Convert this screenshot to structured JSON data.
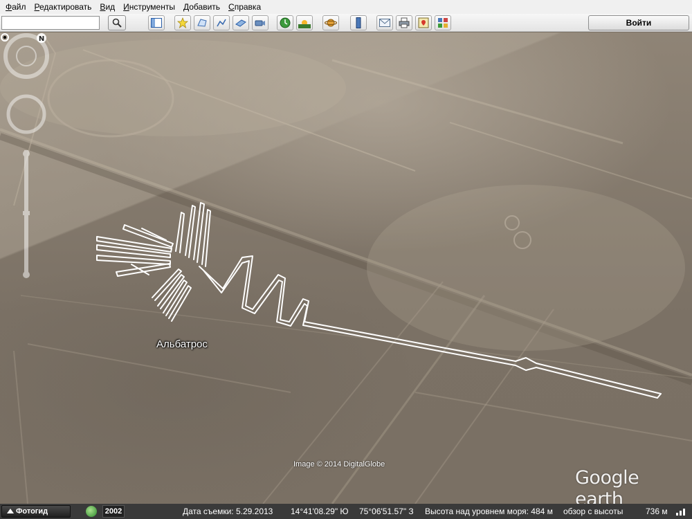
{
  "menu": [
    {
      "label": "Файл",
      "key": "Ф",
      "rest": "айл"
    },
    {
      "label": "Редактировать",
      "key": "Р",
      "rest": "едактировать"
    },
    {
      "label": "Вид",
      "key": "В",
      "rest": "ид"
    },
    {
      "label": "Инструменты",
      "key": "И",
      "rest": "нструменты"
    },
    {
      "label": "Добавить",
      "key": "Д",
      "rest": "обавить"
    },
    {
      "label": "Справка",
      "key": "С",
      "rest": "правка"
    }
  ],
  "search": {
    "value": "",
    "placeholder": ""
  },
  "toolbar": {
    "login_label": "Войти",
    "buttons": [
      "sidebar-icon",
      "placemark-icon",
      "polygon-icon",
      "path-icon",
      "image-overlay-icon",
      "record-tour-icon",
      "historical-imagery-icon",
      "sunlight-icon",
      "planets-icon",
      "ruler-icon",
      "email-icon",
      "print-icon",
      "view-in-maps-icon"
    ]
  },
  "map": {
    "placemark_label": "Альбатрос",
    "image_credit": "Image © 2014 DigitalGlobe",
    "logo": "Google earth"
  },
  "statusbar": {
    "tour_label": "Фотогид",
    "year": "2002",
    "imagery_date": "Дата съемки: 5.29.2013",
    "lat": "14°41'08.29\" Ю",
    "lon": "75°06'51.57\" З",
    "elevation": "Высота над уровнем моря:  484 м",
    "eye_alt": "обзор с высоты",
    "eye_alt_value": "736 м"
  },
  "colors": {
    "geoglyph_line": "#ffffff",
    "statusbar": "#3a3a3a",
    "menubar": "#f0f0f0"
  }
}
